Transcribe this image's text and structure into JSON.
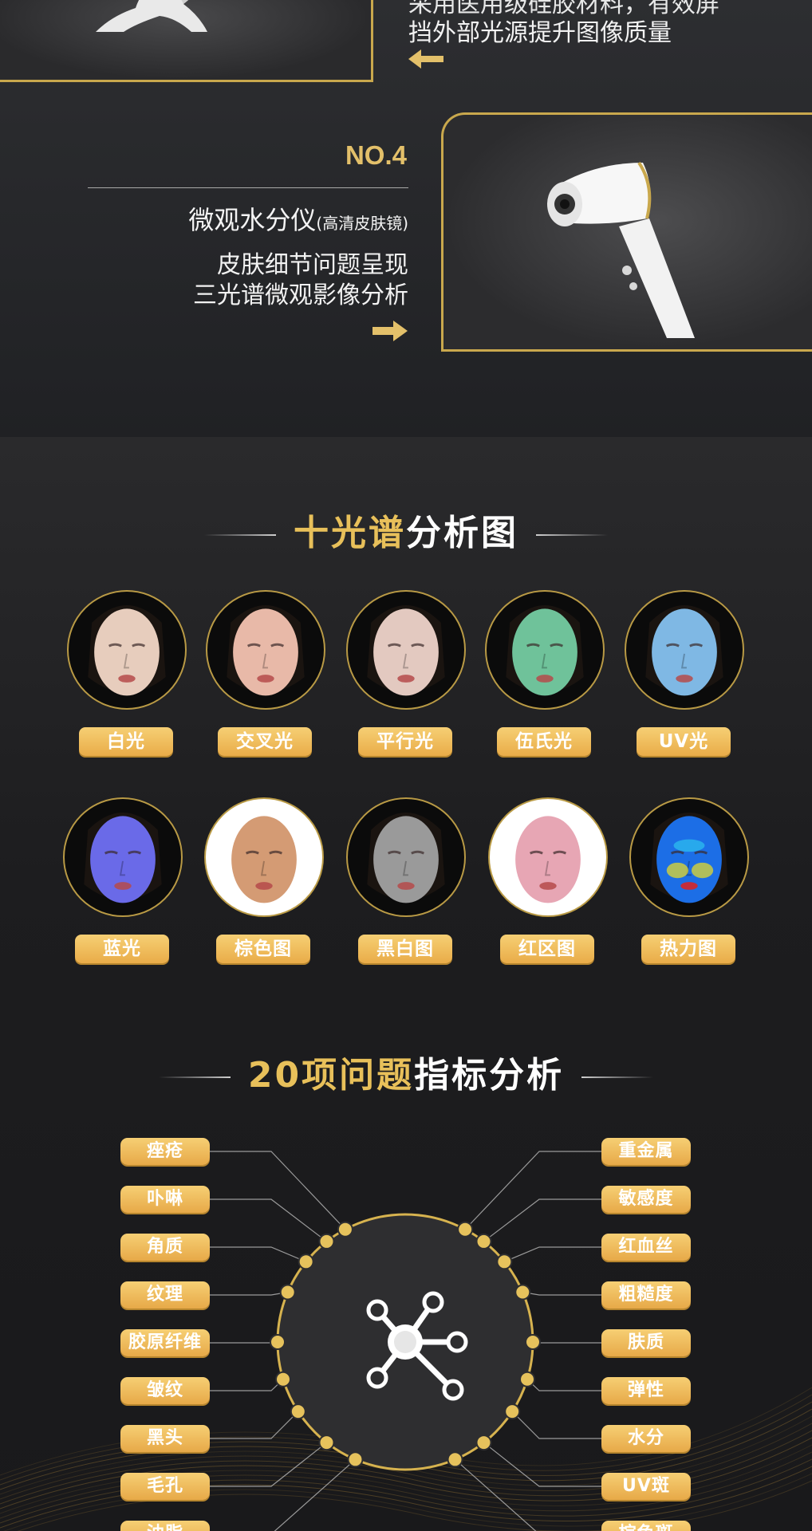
{
  "top": {
    "text_line1": "采用医用级硅胶材料，有效屏",
    "text_line2": "挡外部光源提升图像质量"
  },
  "device4": {
    "number": "NO.4",
    "name": "微观水分仪",
    "name_note": "(高清皮肤镜)",
    "desc_line1": "皮肤细节问题呈现",
    "desc_line2": "三光谱微观影像分析"
  },
  "spectrum": {
    "title_gold": "十光谱",
    "title_white": "分析图",
    "items": [
      {
        "label": "白光",
        "tint": "#e7cdbd"
      },
      {
        "label": "交叉光",
        "tint": "#e8b9a8"
      },
      {
        "label": "平行光",
        "tint": "#e3c9c0"
      },
      {
        "label": "伍氏光",
        "tint": "#6fc29a"
      },
      {
        "label": "UV光",
        "tint": "#7fb8e4"
      },
      {
        "label": "蓝光",
        "tint": "#6a6ae8"
      },
      {
        "label": "棕色图",
        "tint": "#d49b74"
      },
      {
        "label": "黑白图",
        "tint": "#9a9a9a"
      },
      {
        "label": "红区图",
        "tint": "#e7a6b4"
      },
      {
        "label": "热力图",
        "tint": "#1c6ee6"
      }
    ]
  },
  "indicators": {
    "title_gold": "20项问题",
    "title_white": "指标分析",
    "left": [
      "痤疮",
      "卟啉",
      "角质",
      "纹理",
      "胶原纤维",
      "皱纹",
      "黑头",
      "毛孔",
      "油脂"
    ],
    "right": [
      "重金属",
      "敏感度",
      "红血丝",
      "粗糙度",
      "肤质",
      "弹性",
      "水分",
      "UV斑",
      "棕色斑"
    ]
  }
}
